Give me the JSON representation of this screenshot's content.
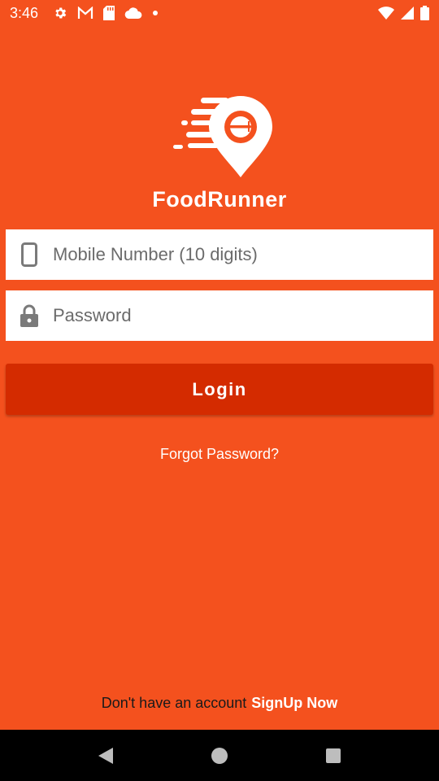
{
  "status_bar": {
    "time": "3:46",
    "icons_left": [
      "gear-icon",
      "gmail-icon",
      "sd-card-icon",
      "cloud-icon",
      "dot-icon"
    ],
    "icons_right": [
      "wifi-icon",
      "signal-icon",
      "battery-icon"
    ]
  },
  "logo": {
    "text": "FoodRunner"
  },
  "form": {
    "mobile_placeholder": "Mobile Number (10 digits)",
    "password_placeholder": "Password",
    "login_label": "Login",
    "forgot_label": "Forgot Password?"
  },
  "footer": {
    "prompt": "Don't have an account",
    "signup_label": "SignUp Now"
  },
  "colors": {
    "background": "#F4511E",
    "button": "#D42B00",
    "nav_bar": "#000000"
  }
}
